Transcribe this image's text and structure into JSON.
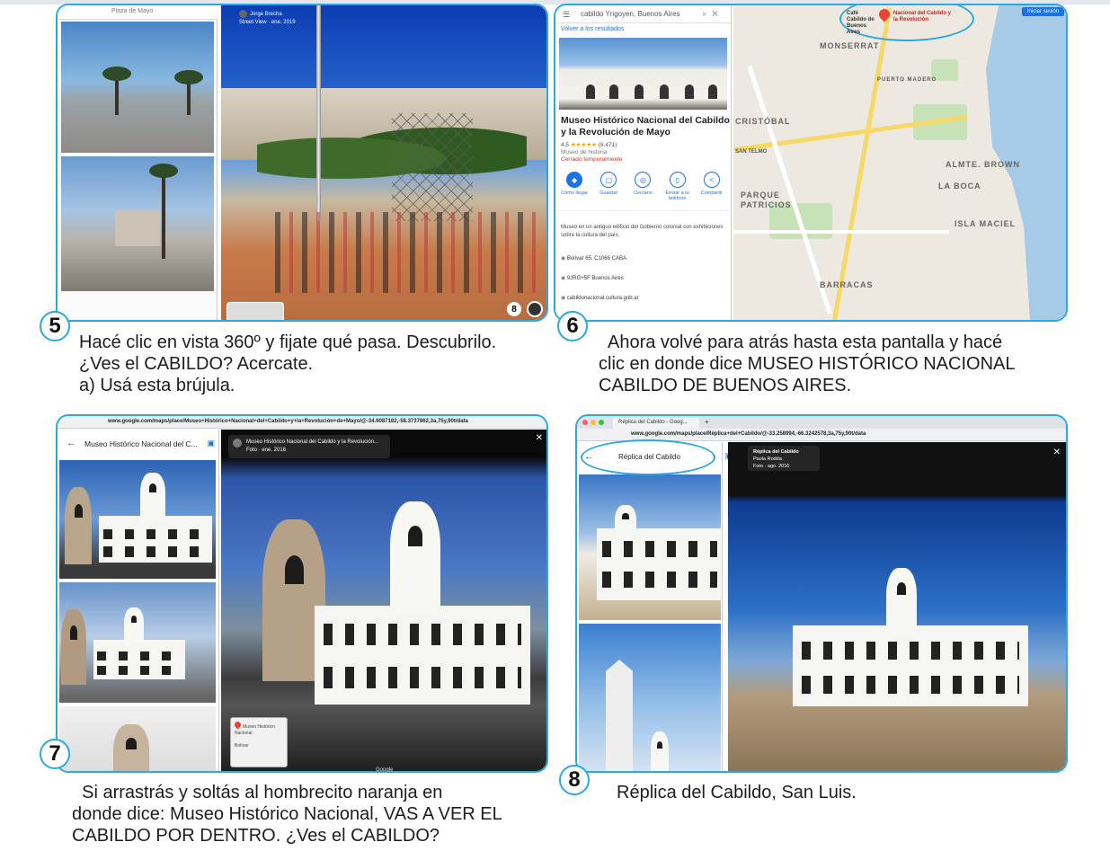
{
  "colors": {
    "accent": "#2aa8e0",
    "map_button": "#1a73e8",
    "closed_text": "#d93025",
    "star": "#f2a20b"
  },
  "steps": [
    {
      "number": "5",
      "caption_lines": [
        "Hacé clic en vista 360º y fijate qué pasa. Descubrilo.",
        "¿Ves el CABILDO? Acercate.",
        "a) Usá esta brújula."
      ]
    },
    {
      "number": "6",
      "caption_lines": [
        "  Ahora volvé para atrás hasta esta pantalla y hacé",
        "clic en donde dice MUSEO HISTÓRICO NACIONAL",
        "CABILDO DE BUENOS AIRES."
      ]
    },
    {
      "number": "7",
      "caption_lines": [
        "  Si arrastrás y soltás al hombrecito naranja en",
        "donde dice: Museo Histórico Nacional, VAS A VER EL",
        "CABILDO POR DENTRO. ¿Ves el CABILDO?"
      ]
    },
    {
      "number": "8",
      "caption_lines": [
        "Réplica del Cabildo, San Luis."
      ]
    }
  ],
  "panel5": {
    "search_text": "Plaza de Mayo",
    "info_author": "Jorge Brecha",
    "info_date": "Street View · ene. 2019",
    "badge": "8"
  },
  "panel6": {
    "search_text": "cabildo Yrigoyen, Buenos Aires",
    "back_link": "Volver a los resultados",
    "place_title": "Museo Histórico Nacional del Cabildo y la Revolución de Mayo",
    "rating": "4,5",
    "stars": "★★★★★",
    "reviews": "(8.471)",
    "place_type": "Museo de historia",
    "status": "Cerrado temporalmente",
    "actions": [
      {
        "icon": "◆",
        "label": "Cómo llegar"
      },
      {
        "icon": "▢",
        "label": "Guardar"
      },
      {
        "icon": "◎",
        "label": "Cercano"
      },
      {
        "icon": "▯",
        "label": "Enviar a tu teléfono"
      },
      {
        "icon": "<",
        "label": "Compartir"
      }
    ],
    "description": "Museo en un antiguo edificio del Gobierno colonial con exhibiciones sobre la cultura del país.",
    "address": "Bolívar 65, C1066 CABA",
    "plus_code": "9JRG+5F Buenos Aires",
    "website": "cabildonacional.cultura.gob.ar",
    "map_labels": {
      "signin": "Iniciar sesión",
      "monserrat": "MONSERRAT",
      "puerto_madero": "PUERTO MADERO",
      "san_cristobal": "CRISTÓBAL",
      "san_telmo": "SAN TELMO",
      "parque_patricios": "PARQUE PATRICIOS",
      "barracas": "BARRACAS",
      "la_boca": "LA BOCA",
      "isla_maciel": "ISLA MACIEL",
      "almte_brown": "ALMTE. BROWN",
      "pin_cafe": "Café Cabildo de Buenos Aires",
      "pin_museum": "Nacional del Cabildo y la Revolución"
    }
  },
  "panel7": {
    "url": "www.google.com/maps/place/Museo+Histórico+Nacional+del+Cabildo+y+la+Revolución+de+Mayo/@-34.6087182,-58.3737862,3a,75y,90t/data",
    "side_title": "Museo Histórico Nacional del C...",
    "chip_title": "Museo Histórico Nacional del Cabildo y la Revolución...",
    "chip_date": "Foto · ene. 2016",
    "minimap_label": "Museo Histórico Nacional",
    "minimap_street": "Bolívar",
    "google": "Google"
  },
  "panel8": {
    "tab_title": "Réplica del Cabildo - Goog...",
    "url": "www.google.com/maps/place/Réplica+del+Cabildo/@-33.258994,-66.3242578,3a,75y,90t/data",
    "side_title": "Réplica del Cabildo",
    "chip_title": "Réplica del Cabildo",
    "chip_author": "Paola Rodda",
    "chip_date": "Foto · ago. 2016"
  }
}
